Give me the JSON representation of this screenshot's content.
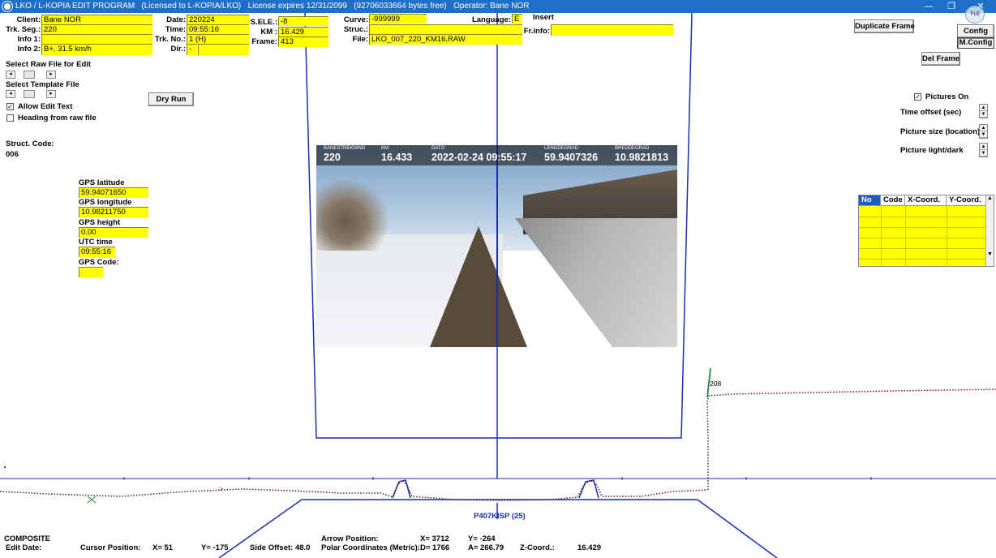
{
  "window": {
    "title": "LKO / L-KOPIA EDIT PROGRAM   (Licensed to L-KOPIA/LKO)   License expires 12/31/2099   (92706033664 bytes free)   Operator: Bane NOR",
    "minimize": "—",
    "maximize": "❐",
    "close": "✕"
  },
  "header_fields": {
    "client": {
      "label": "Client:",
      "value": "Bane NOR"
    },
    "trk_seg": {
      "label": "Trk. Seg.:",
      "value": "220"
    },
    "info1": {
      "label": "Info 1:",
      "value": ""
    },
    "info2": {
      "label": "Info 2:",
      "value": "B+, 31.5 km/h"
    },
    "date": {
      "label": "Date:",
      "value": "220224"
    },
    "time": {
      "label": "Time:",
      "value": "09:55:16"
    },
    "trk_no": {
      "label": "Trk. No.:",
      "value": "1 (H)"
    },
    "dir": {
      "label": "Dir.:",
      "value": "-"
    },
    "s_ele": {
      "label": "S.ELE.:",
      "value": "-8"
    },
    "km": {
      "label": "KM :",
      "value": "16.429"
    },
    "frame": {
      "label": "Frame:",
      "value": "413"
    },
    "curve": {
      "label": "Curve:",
      "value": "-999999"
    },
    "struc": {
      "label": "Struc.:",
      "value": ""
    },
    "file": {
      "label": "File:",
      "value": "LKO_007_220_KM16.RAW"
    },
    "language": {
      "label": "Language:",
      "value": "E"
    },
    "insert": {
      "label": "Insert"
    },
    "fr_info": {
      "label": "Fr.info:",
      "value": ""
    }
  },
  "left_panel": {
    "select_raw_file": "Select Raw File for Edit",
    "select_template_file": "Select Template File",
    "dry_run": "Dry Run",
    "allow_edit_text": "Allow Edit Text",
    "allow_edit_text_checked": true,
    "heading_from_raw": "Heading from raw file",
    "heading_from_raw_checked": false,
    "struct_code_label": "Struct. Code:",
    "struct_code_value": "006"
  },
  "gps": {
    "latitude_label": "GPS latitude",
    "latitude_value": "59.94071650",
    "longitude_label": "GPS longitude",
    "longitude_value": "10.98211750",
    "height_label": "GPS height",
    "height_value": "0.00",
    "utc_label": "UTC time",
    "utc_value": "09:55:16",
    "code_label": "GPS Code:",
    "code_value": ""
  },
  "right_panel": {
    "duplicate_frame": "Duplicate Frame",
    "config": "Config",
    "m_config": "M.Config",
    "del_frame": "Del Frame",
    "pictures_on": "Pictures On",
    "pictures_on_checked": true,
    "time_offset": "Time offset (sec)",
    "picture_size": "Picture size (location)",
    "picture_light": "Picture light/dark",
    "table_headers": [
      "No",
      "Code",
      "X-Coord.",
      "Y-Coord."
    ],
    "corner_icon": "Full"
  },
  "photo_hud": {
    "banestrekning_label": "BANESTREKNING",
    "banestrekning_value": "220",
    "km_label": "KM",
    "km_value": "16.433",
    "dato_label": "DATO",
    "dato_value": "2022-02-24 09:55:17",
    "lengdegrad_label": "LENGDEGRAD",
    "lengdegrad_value": "59.9407326",
    "breddegrad_label": "BREDDEGRAD",
    "breddegrad_value": "10.9821813"
  },
  "profile": {
    "marker_label": "208",
    "profile_name": "P407KISP  (25)"
  },
  "status": {
    "composite": "COMPOSITE",
    "edit_date": "Edit Date:",
    "cursor_position": "Cursor Position:",
    "cursor_x": "X=  51",
    "cursor_y": "Y=  -175",
    "side_offset": "Side Offset:   48.0",
    "arrow_position": "Arrow Position:",
    "polar_coords": "Polar Coordinates (Metric):",
    "arrow_x": "X=  3712",
    "arrow_y": "Y=  -264",
    "polar_d": "D=  1766",
    "polar_a": "A=  266.79",
    "z_coord": "Z-Coord.:",
    "z_value": "16.429"
  },
  "colors": {
    "titlebar": "#1f6fc8",
    "field": "#ffff00",
    "outline": "#1a2fb0",
    "profile_points": "#5a1f3a",
    "marker_green": "#1a8a3a"
  }
}
